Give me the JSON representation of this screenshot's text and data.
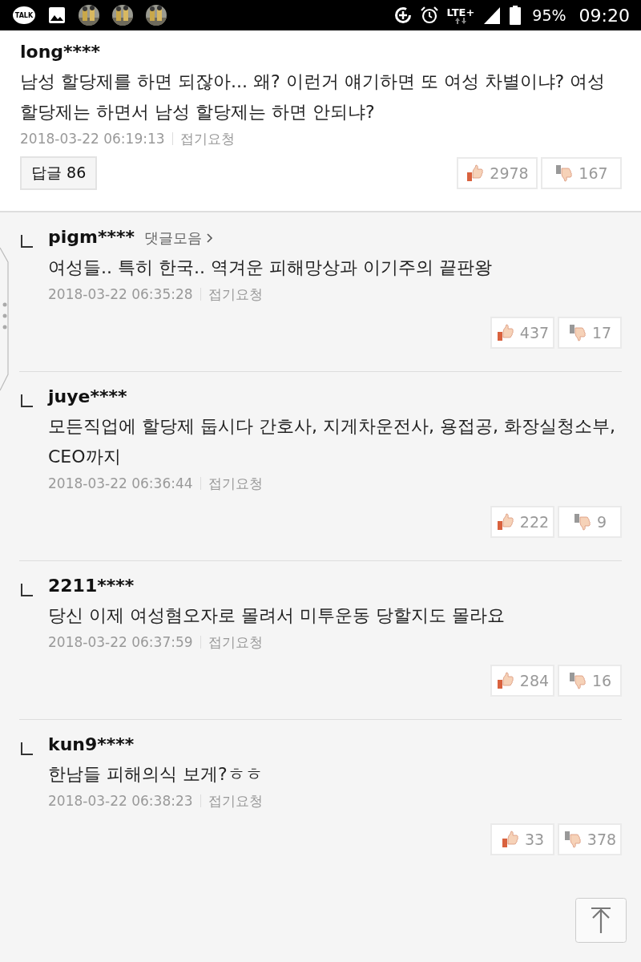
{
  "status_bar": {
    "network": "LTE+",
    "battery": "95%",
    "time": "09:20",
    "notification_app": "TALK"
  },
  "comments": [
    {
      "kind": "comment",
      "user": "long****",
      "text": "남성 할당제를 하면 되잖아... 왜? 이런거 얘기하면 또 여성 차별이냐? 여성 할당제는 하면서 남성 할당제는 하면 안되냐?",
      "time": "2018-03-22 06:19:13",
      "fold": "접기요청",
      "reply_button": "답글 86",
      "likes": "2978",
      "dislikes": "167"
    },
    {
      "kind": "reply",
      "user": "pigm****",
      "collect": "댓글모음",
      "text": "여성들.. 특히 한국.. 역겨운 피해망상과 이기주의 끝판왕",
      "time": "2018-03-22 06:35:28",
      "fold": "접기요청",
      "likes": "437",
      "dislikes": "17"
    },
    {
      "kind": "reply",
      "user": "juye****",
      "text": "모든직업에 할당제 둡시다 간호사, 지게차운전사, 용접공, 화장실청소부, CEO까지",
      "time": "2018-03-22 06:36:44",
      "fold": "접기요청",
      "likes": "222",
      "dislikes": "9"
    },
    {
      "kind": "reply",
      "user": "2211****",
      "text": "당신 이제 여성혐오자로 몰려서 미투운동 당할지도 몰라요",
      "time": "2018-03-22 06:37:59",
      "fold": "접기요청",
      "likes": "284",
      "dislikes": "16"
    },
    {
      "kind": "reply",
      "user": "kun9****",
      "text": "한남들 피해의식 보게?ㅎㅎ",
      "time": "2018-03-22 06:38:23",
      "fold": "접기요청",
      "likes": "33",
      "dislikes": "378"
    }
  ]
}
